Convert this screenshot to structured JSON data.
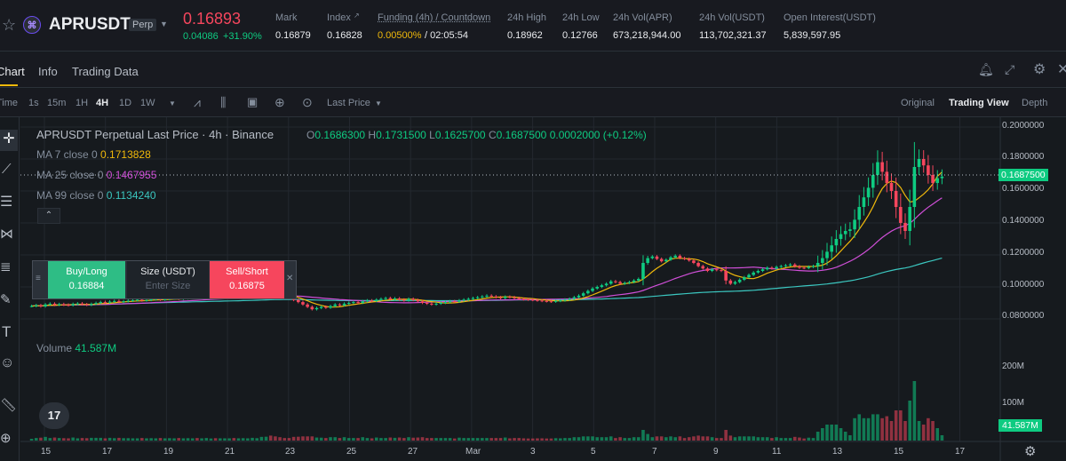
{
  "header": {
    "symbol": "APRUSDT",
    "badge": "Perp",
    "price": "0.16893",
    "change_abs": "0.04086",
    "change_pct": "+31.90%",
    "stats": [
      {
        "label": "Mark",
        "value": "0.16879"
      },
      {
        "label": "Index",
        "value": "0.16828"
      },
      {
        "label": "Funding (4h) / Countdown",
        "value_a": "0.00500%",
        "value_b": "/ 02:05:54"
      },
      {
        "label": "24h High",
        "value": "0.18962"
      },
      {
        "label": "24h Low",
        "value": "0.12766"
      },
      {
        "label": "24h Vol(APR)",
        "value": "673,218,944.00"
      },
      {
        "label": "24h Vol(USDT)",
        "value": "113,702,321.37"
      },
      {
        "label": "Open Interest(USDT)",
        "value": "5,839,597.95"
      }
    ]
  },
  "tabs": [
    "Chart",
    "Info",
    "Trading Data"
  ],
  "toolbar": {
    "time_label": "Time",
    "intervals": [
      "1s",
      "15m",
      "1H",
      "4H",
      "1D",
      "1W"
    ],
    "active_interval": "4H",
    "price_source": "Last Price",
    "views": [
      "Original",
      "Trading View",
      "Depth"
    ],
    "active_view": "Trading View"
  },
  "chart_legend": {
    "title": "APRUSDT Perpetual Last Price · 4h · Binance",
    "o_label": "O",
    "o": "0.1686300",
    "h_label": "H",
    "h": "0.1731500",
    "l_label": "L",
    "l": "0.1625700",
    "c_label": "C",
    "c": "0.1687500",
    "chg": "0.0002000 (+0.12%)",
    "ma7_label": "MA 7 close 0",
    "ma7": "0.1713828",
    "ma25_label": "MA 25 close 0",
    "ma25": "0.1467955",
    "ma99_label": "MA 99 close 0",
    "ma99": "0.1134240",
    "volume_label": "Volume",
    "volume": "41.587M"
  },
  "trade_widget": {
    "buy_label": "Buy/Long",
    "buy_price": "0.16884",
    "size_label": "Size (USDT)",
    "size_placeholder": "Enter Size",
    "sell_label": "Sell/Short",
    "sell_price": "0.16875"
  },
  "colors": {
    "up": "#0ecb81",
    "down": "#f6465d",
    "ma7": "#f0b90b",
    "ma25": "#d04fd8",
    "ma99": "#3bc7c0",
    "accent": "#f0b90b"
  },
  "chart_data": {
    "type": "candlestick",
    "y_ticks": [
      "0.2000000",
      "0.1800000",
      "0.1600000",
      "0.1400000",
      "0.1200000",
      "0.1000000",
      "0.0800000"
    ],
    "y_range": [
      0.07,
      0.205
    ],
    "current_price_tag": "0.1687500",
    "x_ticks": [
      "15",
      "17",
      "19",
      "21",
      "23",
      "25",
      "27",
      "Mar",
      "3",
      "5",
      "7",
      "9",
      "11",
      "13",
      "15",
      "17"
    ],
    "volume_ticks": [
      "200M",
      "100M"
    ],
    "volume_tag": "41.587M",
    "close_series": [
      0.088,
      0.0885,
      0.0878,
      0.089,
      0.0895,
      0.0887,
      0.0892,
      0.0888,
      0.0885,
      0.0893,
      0.0896,
      0.0891,
      0.0887,
      0.0893,
      0.0899,
      0.0905,
      0.0902,
      0.0908,
      0.0912,
      0.0906,
      0.091,
      0.0914,
      0.0917,
      0.092,
      0.0915,
      0.0918,
      0.0922,
      0.0925,
      0.092,
      0.0923,
      0.0927,
      0.093,
      0.0925,
      0.0928,
      0.0932,
      0.0935,
      0.093,
      0.0933,
      0.0938,
      0.094,
      0.0936,
      0.0939,
      0.0942,
      0.0945,
      0.094,
      0.0943,
      0.0947,
      0.095,
      0.0956,
      0.096,
      0.0972,
      0.0985,
      0.0965,
      0.095,
      0.094,
      0.0935,
      0.093,
      0.0918,
      0.0905,
      0.089,
      0.0875,
      0.086,
      0.0868,
      0.0875,
      0.087,
      0.088,
      0.089,
      0.0885,
      0.0895,
      0.09,
      0.0905,
      0.09,
      0.091,
      0.0915,
      0.0912,
      0.092,
      0.0925,
      0.093,
      0.0922,
      0.0928,
      0.092,
      0.0915,
      0.0925,
      0.0918,
      0.091,
      0.09,
      0.0895,
      0.089,
      0.0895,
      0.09,
      0.0905,
      0.091,
      0.0908,
      0.0915,
      0.092,
      0.0925,
      0.093,
      0.0935,
      0.094,
      0.0945,
      0.094,
      0.0935,
      0.093,
      0.0938,
      0.0935,
      0.093,
      0.0925,
      0.0922,
      0.092,
      0.0918,
      0.0915,
      0.0912,
      0.091,
      0.0908,
      0.0912,
      0.0915,
      0.092,
      0.0925,
      0.0935,
      0.0945,
      0.096,
      0.0975,
      0.099,
      0.1,
      0.101,
      0.102,
      0.1035,
      0.103,
      0.102,
      0.1025,
      0.103,
      0.104,
      0.105,
      0.115,
      0.118,
      0.119,
      0.1175,
      0.116,
      0.117,
      0.1185,
      0.1195,
      0.118,
      0.1175,
      0.1165,
      0.115,
      0.113,
      0.1115,
      0.11,
      0.111,
      0.1105,
      0.11,
      0.104,
      0.102,
      0.103,
      0.1045,
      0.106,
      0.1075,
      0.109,
      0.11,
      0.111,
      0.112,
      0.1115,
      0.1125,
      0.113,
      0.1135,
      0.114,
      0.1128,
      0.112,
      0.1118,
      0.1125,
      0.113,
      0.115,
      0.118,
      0.122,
      0.126,
      0.13,
      0.133,
      0.135,
      0.136,
      0.142,
      0.15,
      0.156,
      0.162,
      0.17,
      0.178,
      0.172,
      0.165,
      0.16,
      0.15,
      0.14,
      0.135,
      0.15,
      0.175,
      0.18,
      0.176,
      0.17,
      0.165,
      0.168,
      0.169
    ]
  }
}
